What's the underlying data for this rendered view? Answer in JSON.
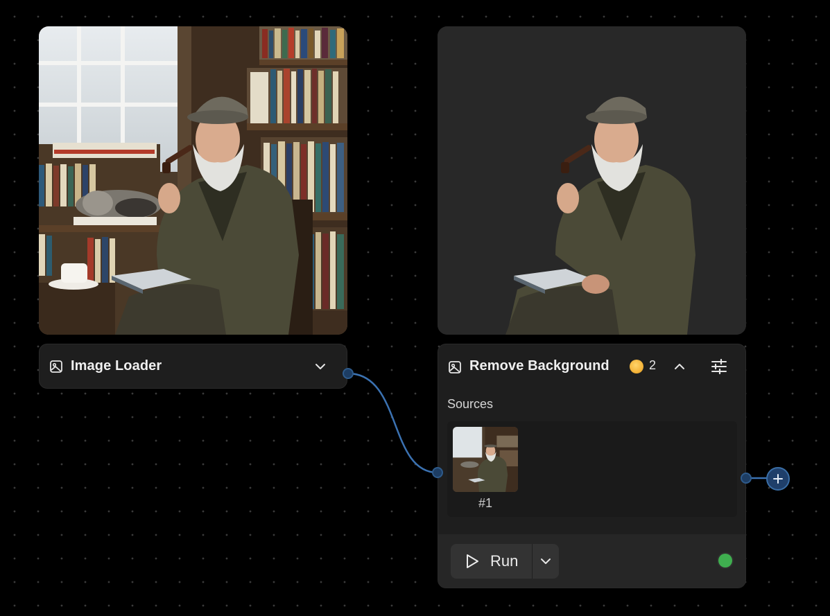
{
  "canvas": {
    "accent_color": "#3f7fc4",
    "status_color": "#3fae4f"
  },
  "image_loader": {
    "title": "Image Loader",
    "icon": "image-icon",
    "toggle_icon": "chevron-down-icon",
    "preview_subject": "elderly man with pipe in bookshop"
  },
  "remove_background": {
    "title": "Remove Background",
    "icon": "image-icon",
    "credits": "2",
    "collapse_icon": "chevron-up-icon",
    "settings_icon": "sliders-icon",
    "sources_label": "Sources",
    "sources": [
      {
        "label": "#1"
      }
    ],
    "run_label": "Run",
    "run_icon": "play-icon",
    "run_menu_icon": "chevron-down-icon",
    "status": "ready"
  },
  "connection": {
    "from": "Image Loader",
    "to": "Remove Background"
  },
  "add_output_icon": "plus-icon"
}
